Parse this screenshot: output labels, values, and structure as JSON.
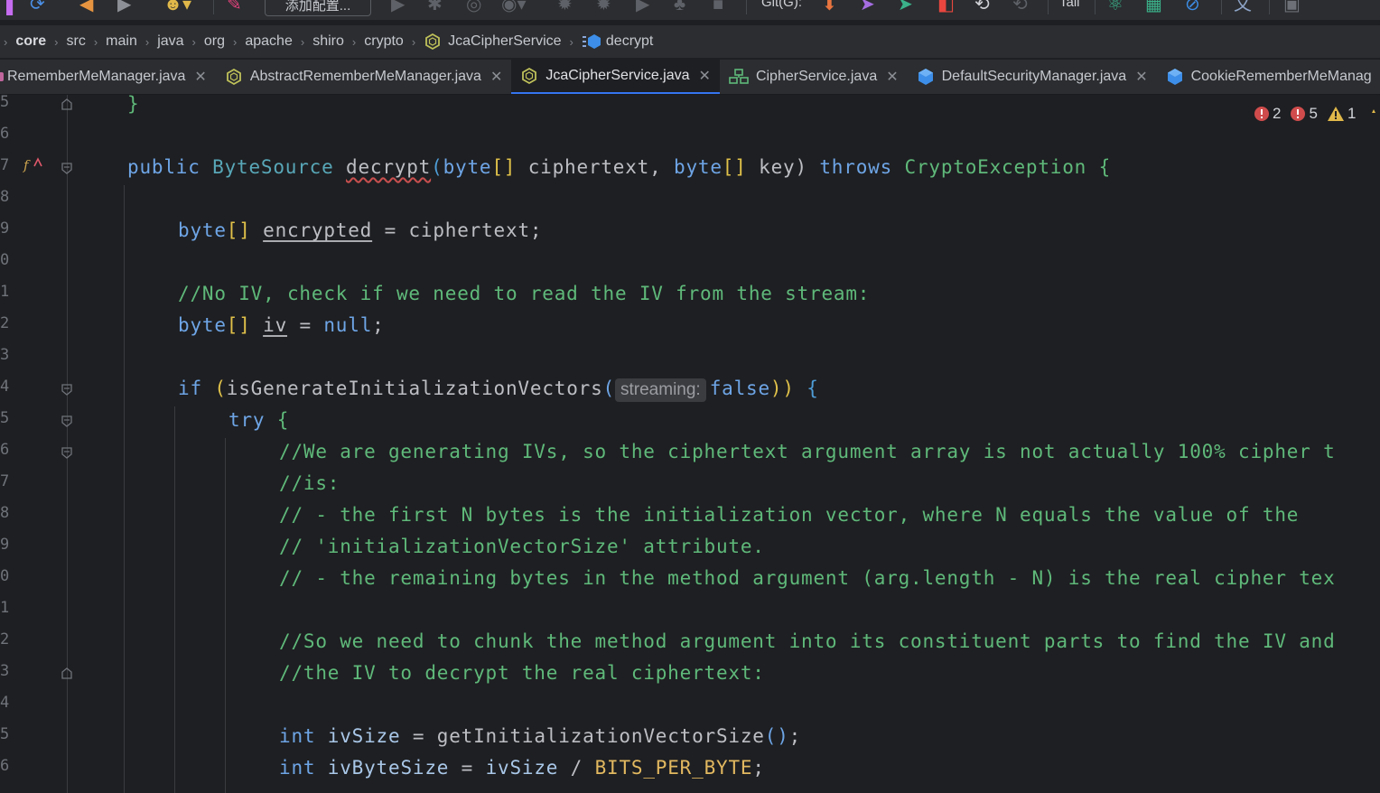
{
  "toolbar": {
    "run_config_label": "添加配置...",
    "git_label": "Git(G):",
    "tail_label": "Tail"
  },
  "breadcrumb": [
    {
      "label": "core",
      "icon": "none"
    },
    {
      "label": "src",
      "icon": "none"
    },
    {
      "label": "main",
      "icon": "none"
    },
    {
      "label": "java",
      "icon": "none"
    },
    {
      "label": "org",
      "icon": "none"
    },
    {
      "label": "apache",
      "icon": "none"
    },
    {
      "label": "shiro",
      "icon": "none"
    },
    {
      "label": "crypto",
      "icon": "none"
    },
    {
      "label": "JcaCipherService",
      "icon": "abstract-class-icon"
    },
    {
      "label": "decrypt",
      "icon": "method-icon"
    }
  ],
  "tabs": [
    {
      "label": "RememberMeManager.java",
      "icon": "interface-icon",
      "active": false
    },
    {
      "label": "AbstractRememberMeManager.java",
      "icon": "abstract-class-icon",
      "active": false
    },
    {
      "label": "JcaCipherService.java",
      "icon": "abstract-class-icon",
      "active": true
    },
    {
      "label": "CipherService.java",
      "icon": "interface-icon",
      "active": false
    },
    {
      "label": "DefaultSecurityManager.java",
      "icon": "class-icon",
      "active": false
    },
    {
      "label": "CookieRememberMeManag",
      "icon": "class-icon",
      "active": false
    }
  ],
  "inspections": {
    "errors_a": "2",
    "errors_b": "5",
    "warnings": "1"
  },
  "line_numbers": [
    "5",
    "6",
    "7",
    "8",
    "9",
    "0",
    "1",
    "2",
    "3",
    "4",
    "5",
    "6",
    "7",
    "8",
    "9",
    "0",
    "1",
    "2",
    "3",
    "4",
    "5",
    "6"
  ],
  "code": {
    "l0": "}",
    "l2_kw": "public",
    "l2_type": "ByteSource",
    "l2_fn": "decrypt",
    "l2_p1": "(",
    "l2_byte1": "byte",
    "l2_arr1": "[]",
    "l2_arg1": " ciphertext, ",
    "l2_byte2": "byte",
    "l2_arr2": "[]",
    "l2_arg2": " key) ",
    "l2_throws": "throws",
    "l2_exc": "CryptoException",
    "l2_brace": "{",
    "l4_type": "byte",
    "l4_arr": "[]",
    "l4_var": "encrypted",
    "l4_rest": " = ciphertext;",
    "l6_comment": "//No IV, check if we need to read the IV from the stream:",
    "l7_type": "byte",
    "l7_arr": "[]",
    "l7_var": "iv",
    "l7_eq": " = ",
    "l7_null": "null",
    "l7_semi": ";",
    "l9_if": "if",
    "l9_open": "(",
    "l9_call": "isGenerateInitializationVectors",
    "l9_paren": "(",
    "l9_hint": "streaming:",
    "l9_false": "false",
    "l9_close": "))",
    "l9_brace": "{",
    "l10_try": "try",
    "l10_brace": "{",
    "l11": "//We are generating IVs, so the ciphertext argument array is not actually 100% cipher t",
    "l12": "//is:",
    "l13": "// - the first N bytes is the initialization vector, where N equals the value of the",
    "l14": "// 'initializationVectorSize' attribute.",
    "l15": "// - the remaining bytes in the method argument (arg.length - N) is the real cipher tex",
    "l17": "//So we need to chunk the method argument into its constituent parts to find the IV and",
    "l18": "//the IV to decrypt the real ciphertext:",
    "l20_int": "int",
    "l20_var": " ivSize",
    "l20_rest": " = getInitializationVectorSize",
    "l20_parens": "()",
    "l20_semi": ";",
    "l21_int": "int",
    "l21_var": " ivByteSize",
    "l21_eq": " = ",
    "l21_var2": "ivSize",
    "l21_div": " / ",
    "l21_const": "BITS_PER_BYTE",
    "l21_semi": ";"
  },
  "colors": {
    "background": "#1e1f22",
    "keyword": "#6ea5e6",
    "comment": "#5fb97a",
    "constant": "#e2b860",
    "active_tab_underline": "#3574f0"
  }
}
